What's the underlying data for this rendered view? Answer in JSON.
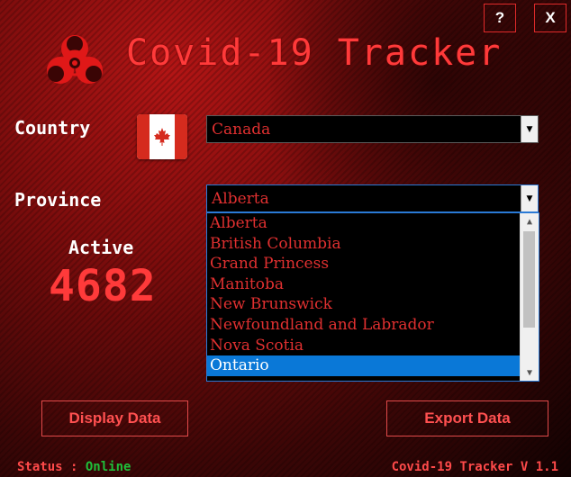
{
  "window": {
    "help_label": "?",
    "close_label": "X",
    "title": "Covid-19 Tracker"
  },
  "colors": {
    "accent": "#ff3a3a",
    "online": "#1fbf3a",
    "selection": "#0a78d7"
  },
  "icons": {
    "logo": "biohazard-icon",
    "flag": "canada-flag-icon"
  },
  "country": {
    "label": "Country",
    "selected": "Canada"
  },
  "province": {
    "label": "Province",
    "selected": "Alberta",
    "options": [
      "Alberta",
      "British Columbia",
      "Grand Princess",
      "Manitoba",
      "New Brunswick",
      "Newfoundland and Labrador",
      "Nova Scotia",
      "Ontario"
    ],
    "highlighted": "Ontario"
  },
  "stats": {
    "active_label": "Active",
    "active_value": "4682"
  },
  "actions": {
    "display_label": "Display Data",
    "export_label": "Export Data"
  },
  "footer": {
    "status_label": "Status : ",
    "status_value": "Online",
    "version": "Covid-19 Tracker V 1.1"
  }
}
